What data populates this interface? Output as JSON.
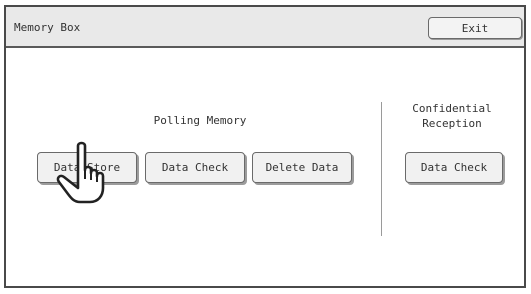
{
  "window": {
    "title": "Memory Box",
    "exit_label": "Exit"
  },
  "polling": {
    "heading": "Polling Memory",
    "buttons": {
      "data_store": "Data Store",
      "data_check": "Data Check",
      "delete_data": "Delete Data"
    }
  },
  "confidential": {
    "heading_line1": "Confidential",
    "heading_line2": "Reception",
    "data_check": "Data Check"
  },
  "icons": {
    "cursor": "pointing-hand-cursor-icon"
  }
}
